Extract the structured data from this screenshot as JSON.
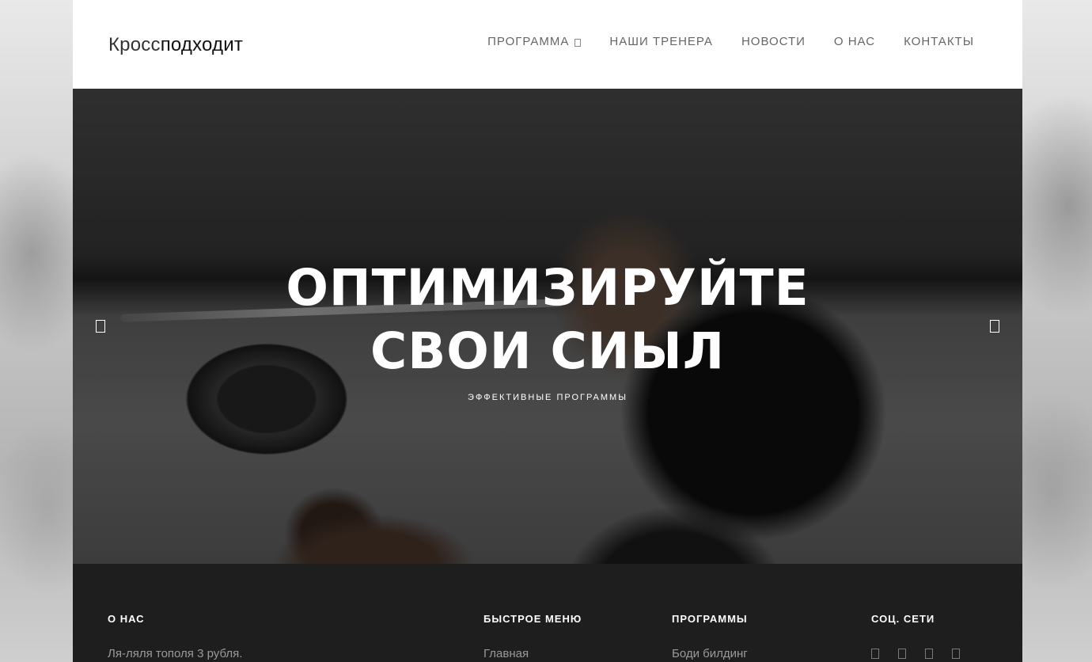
{
  "header": {
    "logo_part1": "Кросс",
    "logo_part2": "подходит",
    "nav": [
      {
        "label": "ПРОГРАММА"
      },
      {
        "label": "НАШИ ТРЕНЕРА"
      },
      {
        "label": "НОВОСТИ"
      },
      {
        "label": "О НАС"
      },
      {
        "label": "КОНТАКТЫ"
      }
    ]
  },
  "hero": {
    "title_line1": "ОПТИМИЗИРУЙТЕ",
    "title_line2": "СВОИ СИЫЛ",
    "subtitle": "ЭФФЕКТИВНЫЕ ПРОГРАММЫ"
  },
  "footer": {
    "about": {
      "heading": "О НАС",
      "text": "Ля-ляля тополя 3 рубля."
    },
    "quick_menu": {
      "heading": "БЫСТРОЕ МЕНЮ",
      "first_item": "Главная"
    },
    "programs": {
      "heading": "ПРОГРАММЫ",
      "first_item": "Боди билдинг"
    },
    "social": {
      "heading": "СОЦ. СЕТИ"
    }
  },
  "colors": {
    "header_bg": "#ffffff",
    "footer_bg": "#1e1e1e",
    "hero_text": "#ffffff",
    "nav_text": "#666666"
  }
}
